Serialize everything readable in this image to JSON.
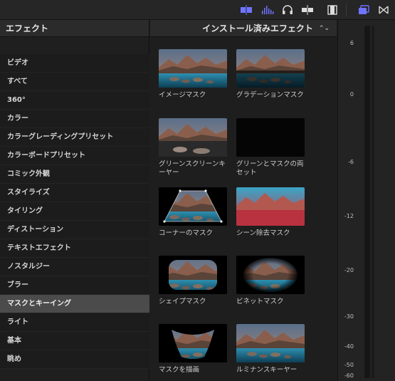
{
  "toolbar": {
    "icons": [
      "video-inspector-icon",
      "audio-meter-icon",
      "headphones-icon",
      "skimming-icon",
      "film-clip-icon",
      "effects-browser-icon",
      "transitions-icon"
    ],
    "accent": "#6f74ff"
  },
  "sidebar": {
    "title": "エフェクト",
    "items": [
      "ビデオ",
      "すべて",
      "360°",
      "カラー",
      "カラーグレーディングプリセット",
      "カラーボードプリセット",
      "コミック外観",
      "スタイライズ",
      "タイリング",
      "ディストーション",
      "テキストエフェクト",
      "ノスタルジー",
      "ブラー",
      "マスクとキーイング",
      "ライト",
      "基本",
      "眺め"
    ],
    "selected": "マスクとキーイング"
  },
  "browser": {
    "dropdown": "インストール済みエフェクト",
    "effects": [
      "イメージマスク",
      "グラデーションマスク",
      "グリーンスクリーンキーヤー",
      "グリーンとマスクの両セット",
      "コーナーのマスク",
      "シーン除去マスク",
      "シェイプマスク",
      "ビネットマスク",
      "マスクを描画",
      "ルミナンスキーヤー"
    ]
  },
  "meter": {
    "ticks": [
      "6",
      "0",
      "-6",
      "-12",
      "-20",
      "-30",
      "-40",
      "-50",
      "-60"
    ]
  }
}
